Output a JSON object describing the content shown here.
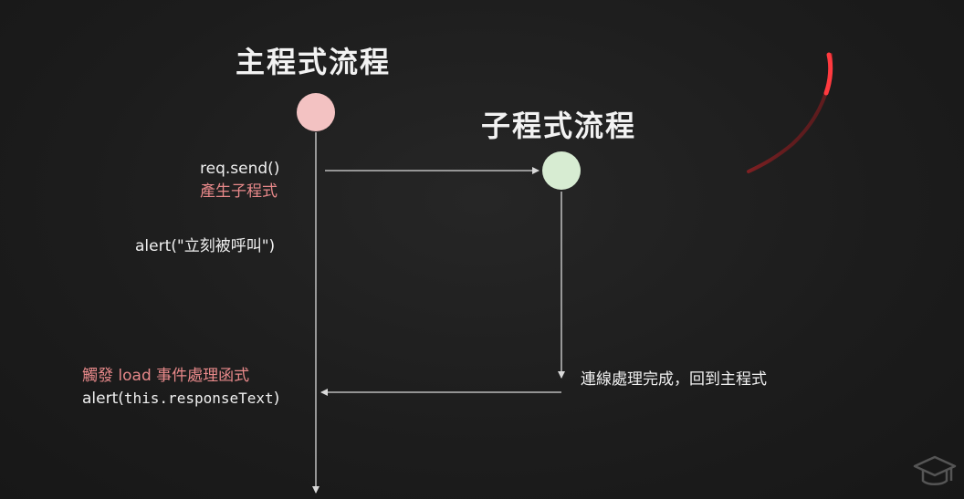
{
  "diagram": {
    "main_title": "主程式流程",
    "sub_title": "子程式流程",
    "colors": {
      "main_node": "#f3c2c2",
      "sub_node": "#d7ecd2",
      "line": "#d9d9d9",
      "highlight_text": "#e8898a",
      "normal_text": "#f0f0f0",
      "pen_stroke": "#d9262a"
    },
    "main_flow": {
      "call": "req.send()",
      "call_note": "產生子程式",
      "immediate": "alert(\"立刻被呼叫\")",
      "event_note": "觸發 load 事件處理函式",
      "event_call_prefix": "alert(",
      "event_call_mono": "this.responseText",
      "event_call_suffix": ")"
    },
    "sub_flow": {
      "return_note": "連線處理完成，回到主程式"
    },
    "icons": {
      "corner": "graduation-cap-icon"
    }
  }
}
